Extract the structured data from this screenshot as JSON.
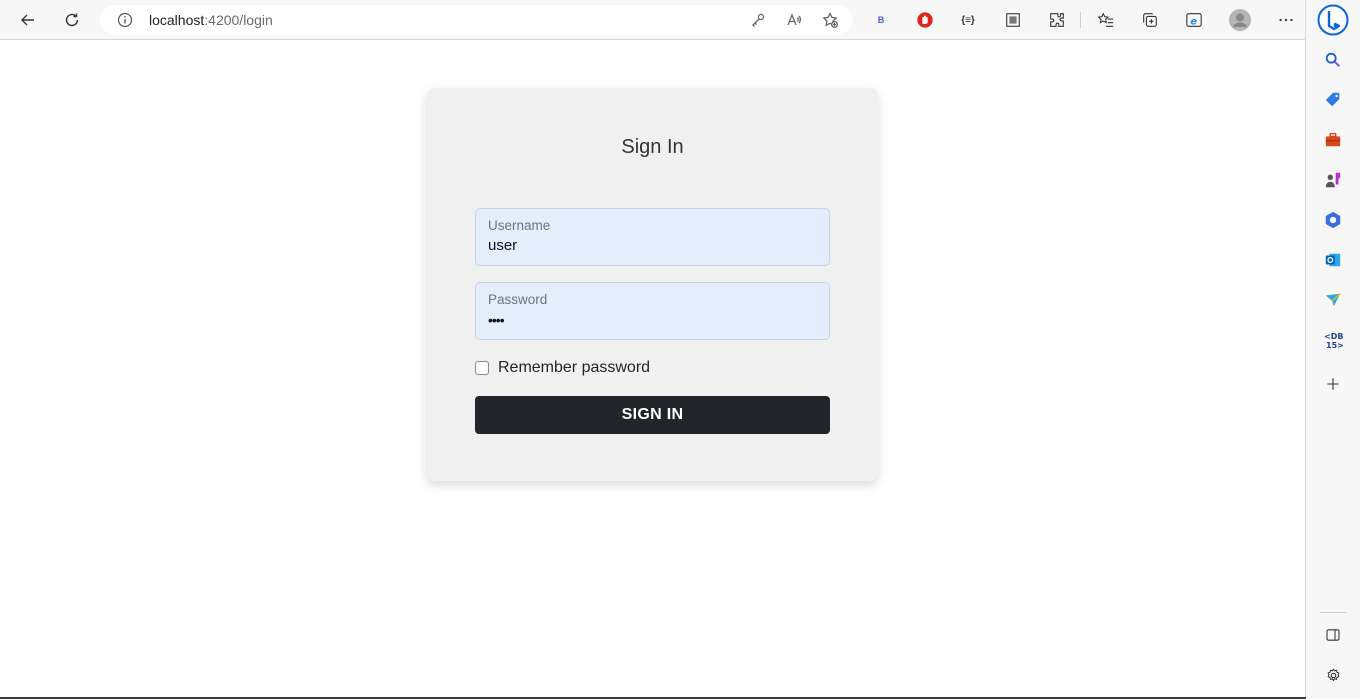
{
  "browser": {
    "url_host": "localhost",
    "url_rest": ":4200/login",
    "extension_b_label": "B",
    "extension_json_label": "{≡}"
  },
  "icons": {
    "back": "back-arrow-icon",
    "refresh": "refresh-icon",
    "info": "info-icon",
    "key": "key-icon",
    "read_aloud": "read-aloud-icon",
    "add_favorite": "add-favorite-icon",
    "sidebar_items": [
      "search-icon",
      "shopping-tag-icon",
      "tools-icon",
      "games-icon",
      "office-icon",
      "outlook-icon",
      "send-icon",
      "db-icon",
      "add-icon"
    ]
  },
  "login": {
    "title": "Sign In",
    "username_label": "Username",
    "username_value": "user",
    "password_label": "Password",
    "password_value": "••••",
    "remember_label": "Remember password",
    "remember_checked": false,
    "submit_label": "SIGN IN"
  },
  "colors": {
    "button_bg": "#212529",
    "field_bg": "#e3edfb",
    "card_bg": "#f0f0f0",
    "bing_blue": "#0a66d8"
  }
}
